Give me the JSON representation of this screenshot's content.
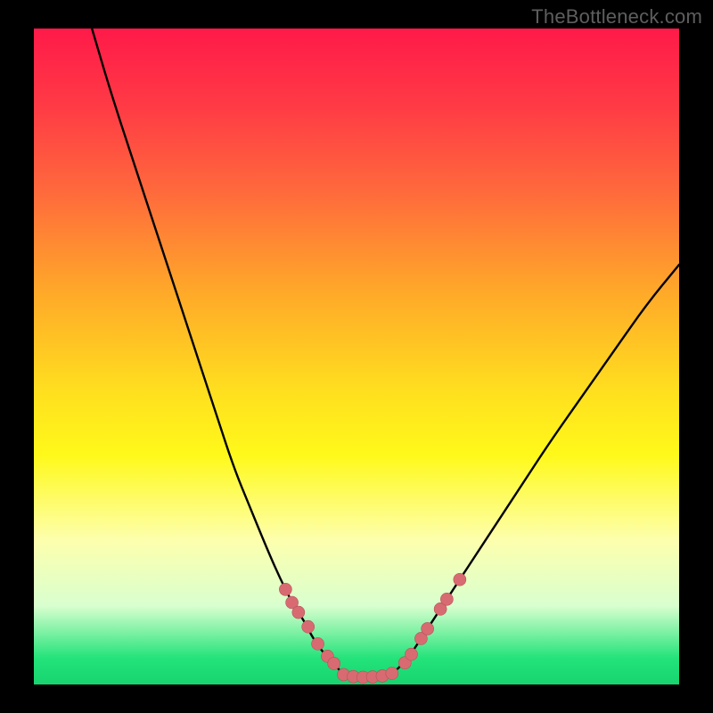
{
  "watermark": "TheBottleneck.com",
  "chart_data": {
    "type": "line",
    "title": "",
    "xlabel": "",
    "ylabel": "",
    "xlim": [
      0,
      100
    ],
    "ylim": [
      0,
      100
    ],
    "series": [
      {
        "name": "left-curve",
        "x": [
          9,
          12,
          16,
          20,
          24,
          28,
          31,
          33.5,
          36,
          38,
          40,
          42,
          43,
          44,
          45,
          46,
          47,
          48
        ],
        "values": [
          100,
          90,
          78,
          66,
          54,
          42,
          33,
          27,
          21,
          16.5,
          12.5,
          9.5,
          7.5,
          6,
          4.7,
          3.6,
          2.6,
          1.5
        ]
      },
      {
        "name": "valley-floor",
        "x": [
          48,
          49,
          50,
          51,
          52,
          53,
          54,
          55,
          56
        ],
        "values": [
          1.5,
          1.2,
          1.1,
          1.1,
          1.1,
          1.2,
          1.3,
          1.5,
          2.0
        ]
      },
      {
        "name": "right-curve",
        "x": [
          56,
          58,
          60,
          62,
          65,
          68,
          72,
          76,
          80,
          85,
          90,
          95,
          100
        ],
        "values": [
          2.0,
          4,
          7,
          10,
          14.5,
          19,
          25,
          31,
          37,
          44,
          51,
          58,
          64
        ]
      }
    ],
    "markers": [
      {
        "series": "left-curve",
        "x": 39,
        "y": 14.5
      },
      {
        "series": "left-curve",
        "x": 40,
        "y": 12.5
      },
      {
        "series": "left-curve",
        "x": 41,
        "y": 11
      },
      {
        "series": "left-curve",
        "x": 42.5,
        "y": 8.8
      },
      {
        "series": "left-curve",
        "x": 44,
        "y": 6.2
      },
      {
        "series": "left-curve",
        "x": 45.5,
        "y": 4.3
      },
      {
        "series": "left-curve",
        "x": 46.5,
        "y": 3.2
      },
      {
        "series": "valley-floor",
        "x": 48,
        "y": 1.5
      },
      {
        "series": "valley-floor",
        "x": 49.5,
        "y": 1.2
      },
      {
        "series": "valley-floor",
        "x": 51,
        "y": 1.1
      },
      {
        "series": "valley-floor",
        "x": 52.5,
        "y": 1.15
      },
      {
        "series": "valley-floor",
        "x": 54,
        "y": 1.3
      },
      {
        "series": "valley-floor",
        "x": 55.5,
        "y": 1.7
      },
      {
        "series": "right-curve",
        "x": 57.5,
        "y": 3.3
      },
      {
        "series": "right-curve",
        "x": 58.5,
        "y": 4.6
      },
      {
        "series": "right-curve",
        "x": 60,
        "y": 7
      },
      {
        "series": "right-curve",
        "x": 61,
        "y": 8.5
      },
      {
        "series": "right-curve",
        "x": 63,
        "y": 11.5
      },
      {
        "series": "right-curve",
        "x": 64,
        "y": 13
      },
      {
        "series": "right-curve",
        "x": 66,
        "y": 16
      }
    ],
    "colors": {
      "curve": "#000000",
      "marker_fill": "#d86b72",
      "marker_stroke": "#b6525a"
    }
  }
}
